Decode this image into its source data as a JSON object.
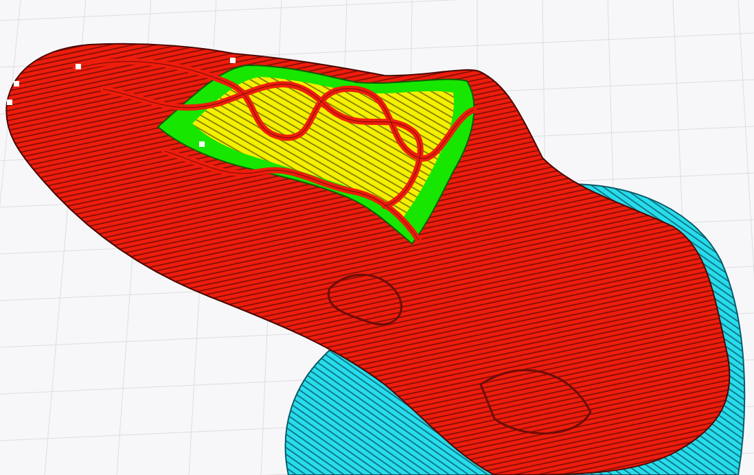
{
  "viewport": {
    "show_grid": true,
    "show_brim": true
  }
}
